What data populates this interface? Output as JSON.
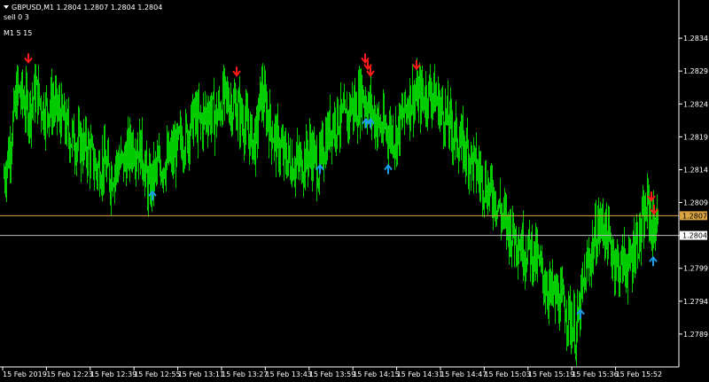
{
  "header": {
    "title": "GBPUSD,M1  1.2804 1.2807 1.2804 1.2804",
    "signal": "sell 0 3",
    "timeframes": "M1 5 15"
  },
  "colors": {
    "background": "#000000",
    "bar": "#00cc00",
    "axis": "#ffffff",
    "ask_line": "#d9a441",
    "bid_line": "#bdbdbd",
    "up_arrow": "#1e9be8",
    "down_arrow": "#ff1a1a"
  },
  "chart_data": {
    "type": "bar",
    "ylim": [
      1.2784,
      1.2839
    ],
    "y_ticks": [
      1.2834,
      1.2829,
      1.2824,
      1.2819,
      1.2814,
      1.2809,
      1.2804,
      1.2799,
      1.2794,
      1.2789
    ],
    "y_tick_labels": [
      "1.2834",
      "1.2829",
      "1.2824",
      "1.2819",
      "1.2814",
      "1.2809",
      "1.2804",
      "1.2799",
      "1.2794",
      "1.2789"
    ],
    "x_labels": [
      "15 Feb 2019",
      "15 Feb 12:23",
      "15 Feb 12:39",
      "15 Feb 12:55",
      "15 Feb 13:11",
      "15 Feb 13:27",
      "15 Feb 13:43",
      "15 Feb 13:59",
      "15 Feb 14:15",
      "15 Feb 14:31",
      "15 Feb 14:47",
      "15 Feb 15:03",
      "15 Feb 15:19",
      "15 Feb 15:36",
      "15 Feb 15:52"
    ],
    "ask_price": 1.2807,
    "ask_label": "1.2807",
    "bid_price": 1.2804,
    "bid_label": "1.2804",
    "close_path": [
      [
        0,
        1.2813
      ],
      [
        6,
        1.2817
      ],
      [
        11,
        1.2822
      ],
      [
        15,
        1.2826
      ],
      [
        20,
        1.2825
      ],
      [
        28,
        1.2823
      ],
      [
        36,
        1.2826
      ],
      [
        45,
        1.2823
      ],
      [
        55,
        1.2824
      ],
      [
        65,
        1.2822
      ],
      [
        75,
        1.2819
      ],
      [
        85,
        1.2818
      ],
      [
        95,
        1.2817
      ],
      [
        105,
        1.2814
      ],
      [
        112,
        1.2815
      ],
      [
        120,
        1.2813
      ],
      [
        128,
        1.2815
      ],
      [
        135,
        1.2815
      ],
      [
        145,
        1.2818
      ],
      [
        155,
        1.2817
      ],
      [
        163,
        1.2811
      ],
      [
        172,
        1.2814
      ],
      [
        180,
        1.2815
      ],
      [
        190,
        1.2816
      ],
      [
        198,
        1.2818
      ],
      [
        206,
        1.2819
      ],
      [
        214,
        1.2822
      ],
      [
        222,
        1.2821
      ],
      [
        230,
        1.2823
      ],
      [
        240,
        1.2822
      ],
      [
        248,
        1.2825
      ],
      [
        256,
        1.2824
      ],
      [
        264,
        1.2823
      ],
      [
        272,
        1.2821
      ],
      [
        278,
        1.2819
      ],
      [
        284,
        1.2818
      ],
      [
        290,
        1.2826
      ],
      [
        296,
        1.2823
      ],
      [
        302,
        1.282
      ],
      [
        308,
        1.2818
      ],
      [
        316,
        1.2816
      ],
      [
        326,
        1.2815
      ],
      [
        336,
        1.2815
      ],
      [
        346,
        1.2817
      ],
      [
        355,
        1.2814
      ],
      [
        362,
        1.2818
      ],
      [
        370,
        1.2821
      ],
      [
        378,
        1.2822
      ],
      [
        386,
        1.2821
      ],
      [
        392,
        1.2824
      ],
      [
        398,
        1.2823
      ],
      [
        403,
        1.2826
      ],
      [
        410,
        1.2824
      ],
      [
        418,
        1.2822
      ],
      [
        426,
        1.282
      ],
      [
        434,
        1.282
      ],
      [
        442,
        1.2819
      ],
      [
        450,
        1.2822
      ],
      [
        458,
        1.2825
      ],
      [
        466,
        1.2825
      ],
      [
        474,
        1.2825
      ],
      [
        482,
        1.2826
      ],
      [
        490,
        1.2824
      ],
      [
        498,
        1.2822
      ],
      [
        506,
        1.282
      ],
      [
        514,
        1.2818
      ],
      [
        522,
        1.2817
      ],
      [
        530,
        1.2815
      ],
      [
        538,
        1.2813
      ],
      [
        546,
        1.2811
      ],
      [
        554,
        1.281
      ],
      [
        562,
        1.2807
      ],
      [
        570,
        1.2805
      ],
      [
        578,
        1.2804
      ],
      [
        586,
        1.2802
      ],
      [
        594,
        1.2802
      ],
      [
        602,
        1.28
      ],
      [
        610,
        1.2797
      ],
      [
        618,
        1.2795
      ],
      [
        626,
        1.2794
      ],
      [
        634,
        1.2793
      ],
      [
        640,
        1.2791
      ],
      [
        646,
        1.2789
      ],
      [
        652,
        1.2795
      ],
      [
        658,
        1.2799
      ],
      [
        664,
        1.2802
      ],
      [
        670,
        1.2805
      ],
      [
        676,
        1.2806
      ],
      [
        682,
        1.2803
      ],
      [
        688,
        1.2801
      ],
      [
        694,
        1.2799
      ],
      [
        700,
        1.28
      ],
      [
        706,
        1.2799
      ],
      [
        712,
        1.2803
      ],
      [
        718,
        1.2804
      ],
      [
        722,
        1.2806
      ],
      [
        727,
        1.2809
      ],
      [
        731,
        1.2805
      ],
      [
        736,
        1.2806
      ],
      [
        738,
        1.2805
      ]
    ],
    "up_arrows": [
      [
        168,
        1.281
      ],
      [
        357,
        1.2814
      ],
      [
        409,
        1.2821
      ],
      [
        414,
        1.2821
      ],
      [
        434,
        1.2814
      ],
      [
        651,
        1.2792
      ],
      [
        733,
        1.28
      ]
    ],
    "down_arrows": [
      [
        28,
        1.2831
      ],
      [
        263,
        1.2829
      ],
      [
        408,
        1.2831
      ],
      [
        411,
        1.283
      ],
      [
        414,
        1.2829
      ],
      [
        466,
        1.283
      ],
      [
        731,
        1.281
      ],
      [
        734,
        1.2808
      ]
    ]
  }
}
